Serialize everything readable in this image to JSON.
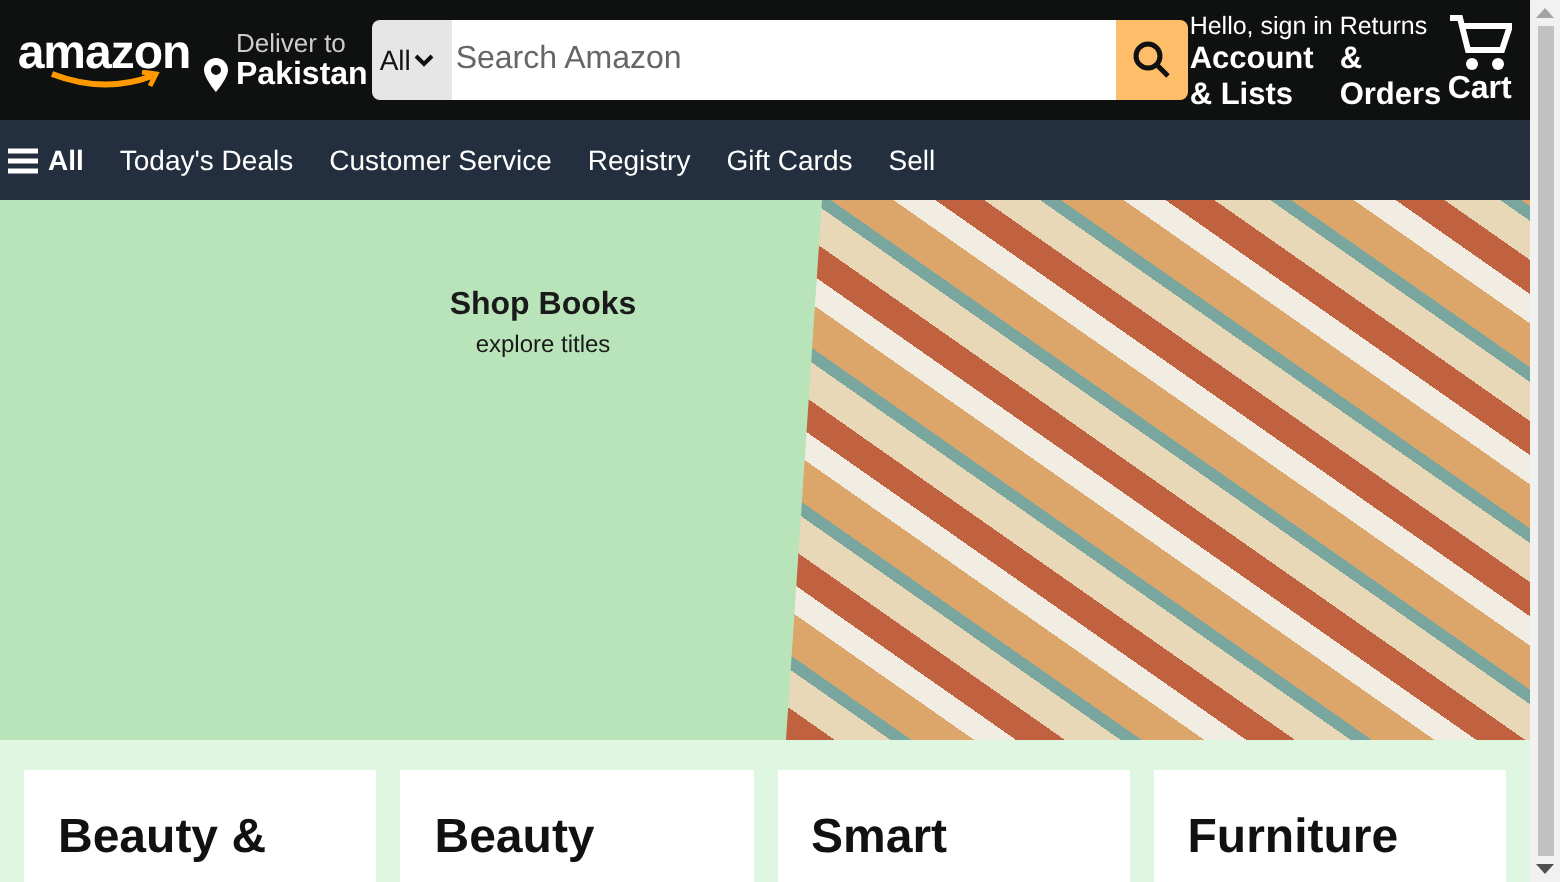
{
  "header": {
    "logo": "amazon",
    "deliver": {
      "line1": "Deliver to",
      "line2": "Pakistan"
    },
    "search": {
      "category": "All",
      "placeholder": "Search Amazon"
    },
    "account": {
      "line1": "Hello, sign in",
      "line2": "Account & Lists"
    },
    "returns": {
      "line1": "Returns",
      "line2": "& Orders"
    },
    "cart": {
      "label": "Cart"
    }
  },
  "nav": {
    "menu": "All",
    "links": [
      "Today's Deals",
      "Customer Service",
      "Registry",
      "Gift Cards",
      "Sell"
    ]
  },
  "hero": {
    "title": "Shop Books",
    "subtitle": "explore titles"
  },
  "cards": [
    {
      "title": "Beauty &"
    },
    {
      "title": "Beauty"
    },
    {
      "title": "Smart"
    },
    {
      "title": "Furniture"
    }
  ]
}
